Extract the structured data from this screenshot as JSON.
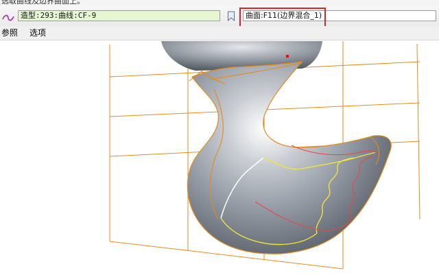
{
  "prompt": {
    "text": "选取曲线及边界曲面上。"
  },
  "toolbar": {
    "curve_field": "造型:293:曲线:CF-9",
    "surface_field": "曲面:F11(边界混合_1)"
  },
  "tabs": [
    {
      "label": "参照"
    },
    {
      "label": "选项"
    }
  ],
  "icons": {
    "curve": "curve-tool-icon",
    "bookmark": "bookmark-icon"
  },
  "colors": {
    "highlight": "#d9232a",
    "field_active": "#e7f7d4",
    "grid": "#e58a1a"
  }
}
